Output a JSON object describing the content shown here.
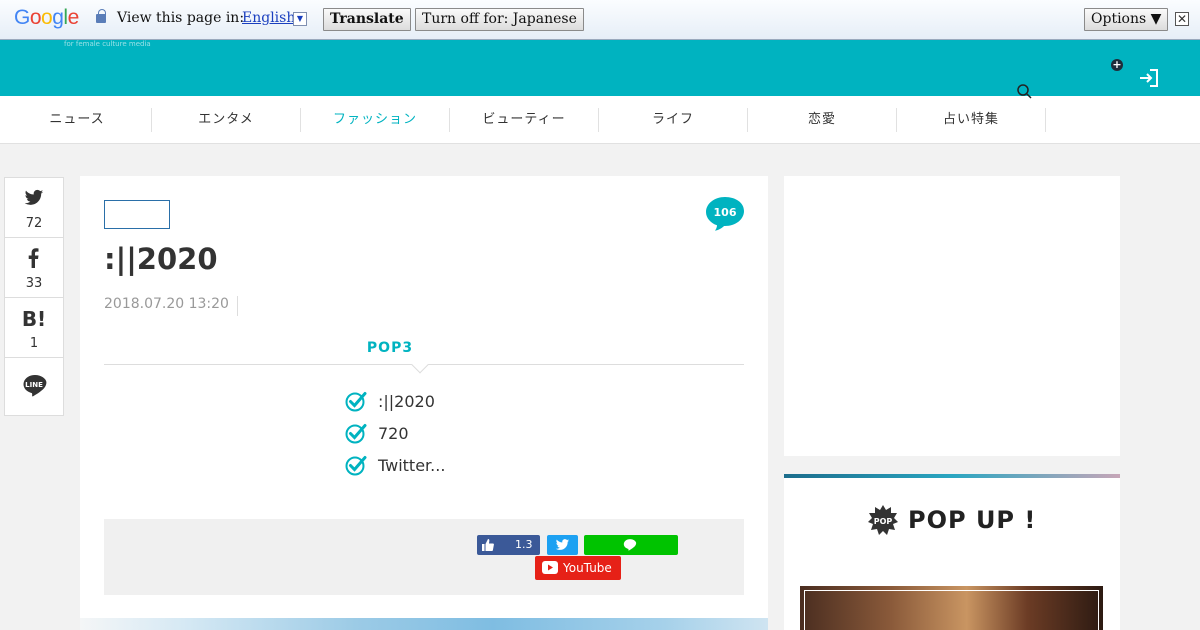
{
  "translate_bar": {
    "logo": "Google",
    "prompt": "View this page in:",
    "language": "English",
    "translate_label": "Translate",
    "turn_off_label": "Turn off for: Japanese",
    "options_label": "Options ▼",
    "close_label": "✕"
  },
  "header": {
    "tagline": "for female culture media"
  },
  "nav": {
    "items": [
      {
        "label": "ニュース"
      },
      {
        "label": "エンタメ"
      },
      {
        "label": "ファッション"
      },
      {
        "label": "ビューティー"
      },
      {
        "label": "ライフ"
      },
      {
        "label": "恋愛"
      },
      {
        "label": "占い特集"
      }
    ],
    "active_index": 2
  },
  "share_sidebar": {
    "twitter_count": "72",
    "facebook_count": "33",
    "hatena_label": "B!",
    "hatena_count": "1",
    "line_label": "LINE"
  },
  "article": {
    "comment_count": "106",
    "title": ":||2020",
    "date": "2018.07.20 13:20",
    "pop3_heading": "POP3",
    "pop3_items": [
      {
        "text": ":||2020"
      },
      {
        "text": "720"
      },
      {
        "text": "Twitter..."
      }
    ],
    "like_count": "1.3",
    "youtube_label": "YouTube"
  },
  "popup": {
    "badge": "POP",
    "title": "POP UP !"
  },
  "colors": {
    "accent": "#00b3c0",
    "facebook": "#3b5998",
    "twitter": "#1da1f2",
    "line": "#00c300",
    "youtube": "#e62117"
  }
}
